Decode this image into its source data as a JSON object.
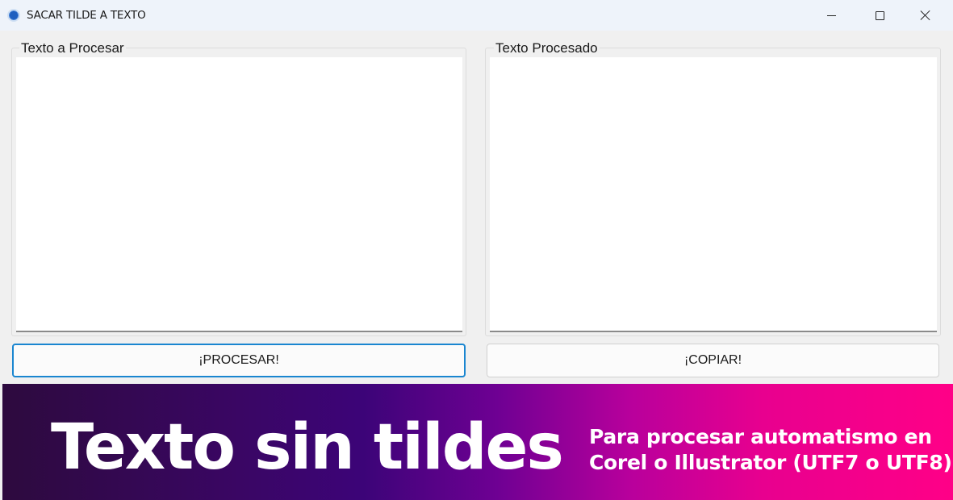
{
  "window": {
    "title": "SACAR TILDE A TEXTO",
    "controls": {
      "minimize": "minimize-icon",
      "maximize": "maximize-icon",
      "close": "close-icon"
    }
  },
  "input_group": {
    "label": "Texto a Procesar",
    "value": ""
  },
  "output_group": {
    "label": "Texto Procesado",
    "value": ""
  },
  "buttons": {
    "process_label": "¡PROCESAR!",
    "copy_label": "¡COPIAR!"
  },
  "banner": {
    "title": "Texto sin tildes",
    "subtitle_line1": "Para procesar automatismo en",
    "subtitle_line2": "Corel o Illustrator (UTF7 o UTF8)"
  },
  "colors": {
    "accent": "#1a86d0",
    "banner_start": "#2d0a3e",
    "banner_end": "#ff0087"
  }
}
